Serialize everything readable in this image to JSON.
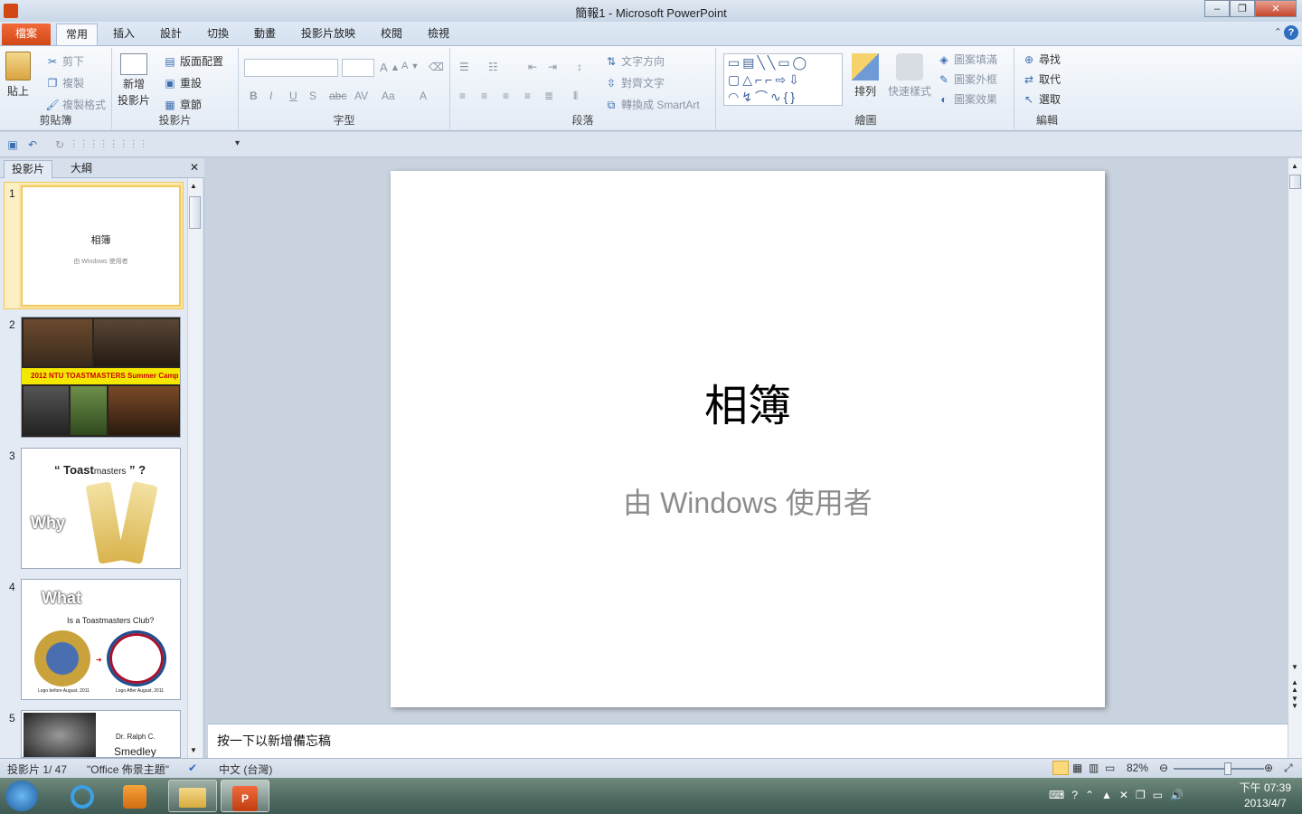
{
  "window": {
    "title": "簡報1 - Microsoft PowerPoint"
  },
  "tabs": [
    "檔案",
    "常用",
    "插入",
    "設計",
    "切換",
    "動畫",
    "投影片放映",
    "校閱",
    "檢視"
  ],
  "ribbon": {
    "clipboard": {
      "name": "剪貼簿",
      "paste": "貼上",
      "cut": "剪下",
      "copy": "複製",
      "format_painter": "複製格式"
    },
    "slides": {
      "name": "投影片",
      "new_slide_l1": "新增",
      "new_slide_l2": "投影片",
      "layout": "版面配置",
      "reset": "重設",
      "section": "章節"
    },
    "font": {
      "name": "字型"
    },
    "paragraph": {
      "name": "段落",
      "text_direction": "文字方向",
      "align_text": "對齊文字",
      "smartart": "轉換成 SmartArt"
    },
    "drawing": {
      "name": "繪圖",
      "arrange": "排列",
      "quick_styles": "快速樣式",
      "shape_fill": "圖案填滿",
      "shape_outline": "圖案外框",
      "shape_effects": "圖案效果"
    },
    "editing": {
      "name": "編輯",
      "find": "尋找",
      "replace": "取代",
      "select": "選取"
    }
  },
  "pane": {
    "tab_slides": "投影片",
    "tab_outline": "大綱"
  },
  "slides": [
    {
      "num": "1",
      "title": "相簿",
      "subtitle": "由 Windows 使用者"
    },
    {
      "num": "2",
      "label": "2012 NTU TOASTMASTERS Summer Camp"
    },
    {
      "num": "3",
      "l1": "Toast",
      "l2": "masters",
      "l3": "Why"
    },
    {
      "num": "4",
      "l1": "What",
      "l2": "Is a Toastmasters Club?",
      "cap1": "Logo before August, 2011",
      "cap2": "Logo After August, 2011"
    },
    {
      "num": "5",
      "l1": "Dr. Ralph C.",
      "l2": "Smedley"
    }
  ],
  "main_slide": {
    "title": "相簿",
    "subtitle": "由 Windows 使用者"
  },
  "notes": {
    "placeholder": "按一下以新增備忘稿"
  },
  "status": {
    "slide": "投影片 1/ 47",
    "theme": "\"Office 佈景主題\"",
    "language": "中文 (台灣)",
    "zoom": "82%",
    "zoom_fraction": 0.82
  },
  "clock": {
    "time": "下午 07:39",
    "date": "2013/4/7"
  }
}
